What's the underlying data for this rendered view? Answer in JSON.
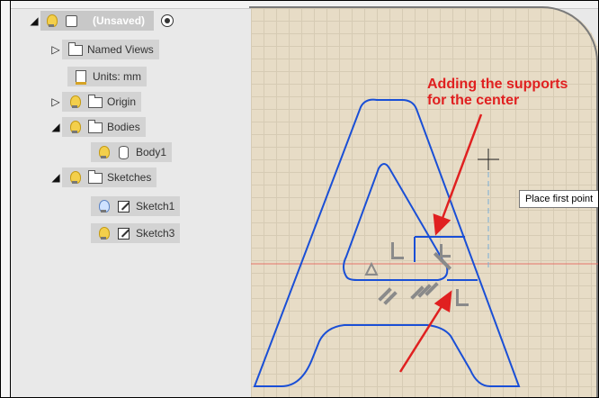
{
  "browser": {
    "root": {
      "label": "(Unsaved)"
    },
    "items": [
      {
        "label": "Named Views"
      },
      {
        "label": "Units: mm"
      },
      {
        "label": "Origin"
      },
      {
        "label": "Bodies"
      },
      {
        "label": "Body1"
      },
      {
        "label": "Sketches"
      },
      {
        "label": "Sketch1"
      },
      {
        "label": "Sketch3"
      }
    ]
  },
  "canvas": {
    "annotation_line1": "Adding the supports",
    "annotation_line2": "for the center",
    "tooltip": "Place first point",
    "colors": {
      "sketch_line": "#1a4fd6",
      "annotation": "#e02020",
      "axis": "#e5736a",
      "construction": "#7aaed6"
    }
  }
}
